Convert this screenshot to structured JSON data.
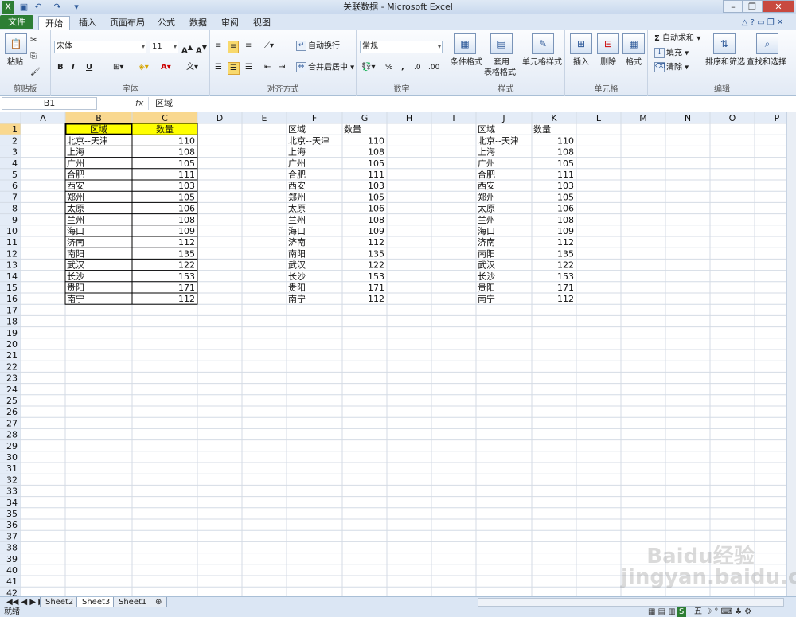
{
  "window": {
    "title": "关联数据 - Microsoft Excel"
  },
  "quick_access": {
    "icons": [
      "excel-logo-icon",
      "save-icon",
      "undo-icon",
      "redo-icon",
      "customize-icon"
    ]
  },
  "tabs": [
    "文件",
    "开始",
    "插入",
    "页面布局",
    "公式",
    "数据",
    "审阅",
    "视图"
  ],
  "active_tab": "开始",
  "ribbon": {
    "clipboard": {
      "group_label": "剪贴板",
      "paste": "粘贴"
    },
    "font": {
      "group_label": "字体",
      "font_name": "宋体",
      "font_size": "11",
      "bold": "B",
      "italic": "I",
      "underline": "U"
    },
    "alignment": {
      "group_label": "对齐方式",
      "wrap": "自动换行",
      "merge": "合并后居中"
    },
    "number": {
      "group_label": "数字",
      "format": "常规"
    },
    "styles": {
      "group_label": "样式",
      "cond_format": "条件格式",
      "table_format_1": "套用",
      "table_format_2": "表格格式",
      "cell_styles": "单元格样式"
    },
    "cells": {
      "group_label": "单元格",
      "insert": "插入",
      "delete": "删除",
      "format": "格式"
    },
    "editing": {
      "group_label": "编辑",
      "autosum": "自动求和",
      "fill": "填充",
      "clear": "清除",
      "sort_filter": "排序和筛选",
      "find_select": "查找和选择"
    }
  },
  "formula_bar": {
    "name_box": "B1",
    "fx": "fx",
    "content": "区域"
  },
  "sheet": {
    "columns": [
      "A",
      "B",
      "C",
      "D",
      "E",
      "F",
      "G",
      "H",
      "I",
      "J",
      "K",
      "L",
      "M",
      "N",
      "O",
      "P"
    ],
    "row_count": 42,
    "table_headers": [
      "区域",
      "数量"
    ],
    "regions": [
      "北京--天津",
      "上海",
      "广州",
      "合肥",
      "西安",
      "郑州",
      "太原",
      "兰州",
      "海口",
      "济南",
      "南阳",
      "武汉",
      "长沙",
      "贵阳",
      "南宁"
    ],
    "quantities": [
      110,
      108,
      105,
      111,
      103,
      105,
      106,
      108,
      109,
      112,
      135,
      122,
      153,
      171,
      112
    ],
    "highlight_color": "#ffff00"
  },
  "sheet_tabs": [
    "Sheet2",
    "Sheet3",
    "Sheet1"
  ],
  "active_sheet": "Sheet3",
  "status": {
    "ready": "就绪"
  },
  "watermark": "Baidu经验 jingyan.baidu.com"
}
